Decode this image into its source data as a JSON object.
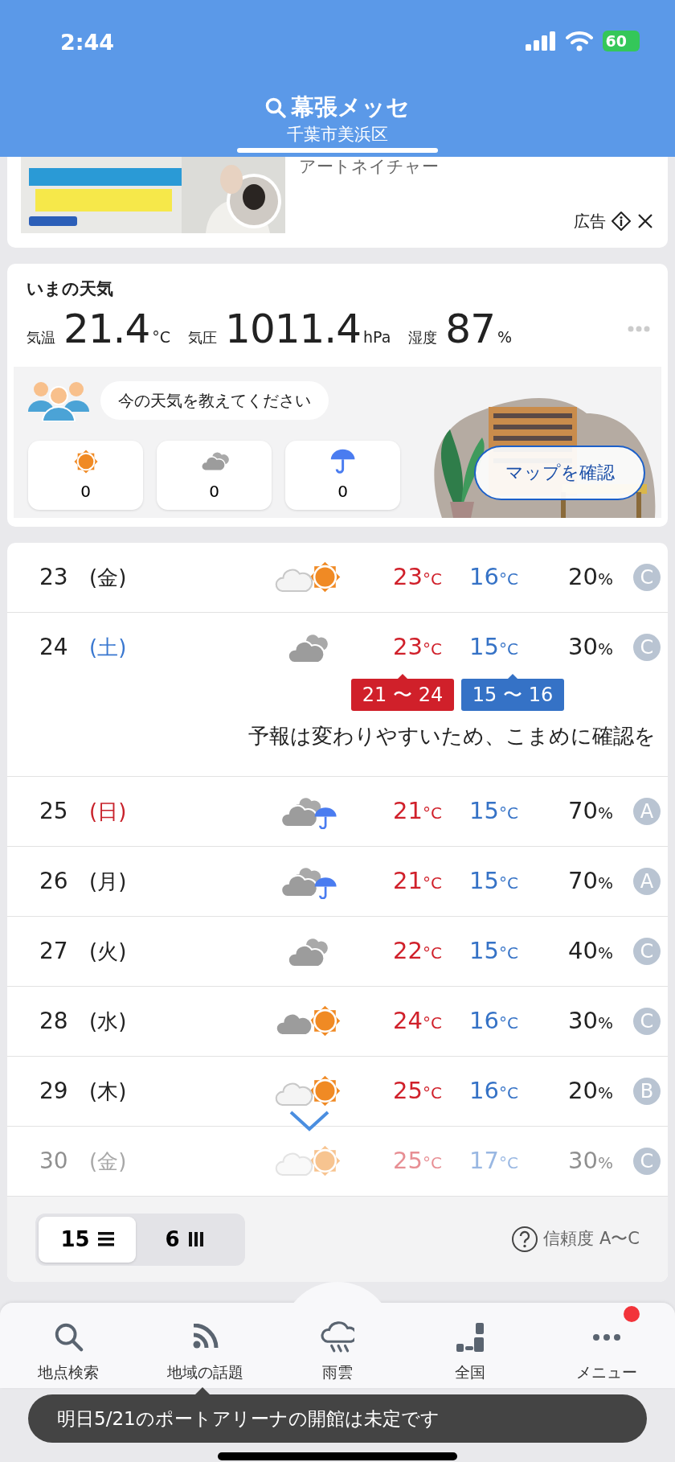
{
  "status_bar": {
    "time": "2:44",
    "battery": "60"
  },
  "header": {
    "title": "幕張メッセ",
    "subtitle": "千葉市美浜区"
  },
  "ad": {
    "kind": "picture",
    "advertiser": "アートネイチャー",
    "label": "広告"
  },
  "current": {
    "title": "いまの天気",
    "readings": [
      {
        "label": "気温",
        "value": "21.4",
        "unit": "°C"
      },
      {
        "label": "気圧",
        "value": "1011.4",
        "unit": "hPa"
      },
      {
        "label": "湿度",
        "value": "87",
        "unit": "%"
      }
    ],
    "prompt": "今の天気を教えてください",
    "reports": [
      {
        "kind": "sunny",
        "count": "0"
      },
      {
        "kind": "cloudy",
        "count": "0"
      },
      {
        "kind": "rain",
        "count": "0"
      }
    ],
    "map_button": "マップを確認"
  },
  "forecast": {
    "days": [
      {
        "date": "23",
        "weekday": "(金)",
        "color": "#222222",
        "kind": "partly_sunny",
        "high": "23",
        "high_unit": "°C",
        "low": "16",
        "low_unit": "°C",
        "pop": "20",
        "pop_unit": "%",
        "reliability": "C",
        "expanded": false,
        "faded": false
      },
      {
        "date": "24",
        "weekday": "(土)",
        "color": "#3a78d0",
        "kind": "cloudy",
        "high": "23",
        "high_unit": "°C",
        "low": "15",
        "low_unit": "°C",
        "pop": "30",
        "pop_unit": "%",
        "reliability": "C",
        "expanded": true,
        "faded": false,
        "high_range": "21 〜 24",
        "low_range": "15 〜 16",
        "note": "予報は変わりやすいため、こまめに確認を"
      },
      {
        "date": "25",
        "weekday": "(日)",
        "color": "#c8222b",
        "kind": "rain",
        "high": "21",
        "high_unit": "°C",
        "low": "15",
        "low_unit": "°C",
        "pop": "70",
        "pop_unit": "%",
        "reliability": "A",
        "expanded": false,
        "faded": false
      },
      {
        "date": "26",
        "weekday": "(月)",
        "color": "#222222",
        "kind": "rain",
        "high": "21",
        "high_unit": "°C",
        "low": "15",
        "low_unit": "°C",
        "pop": "70",
        "pop_unit": "%",
        "reliability": "A",
        "expanded": false,
        "faded": false
      },
      {
        "date": "27",
        "weekday": "(火)",
        "color": "#222222",
        "kind": "cloudy",
        "high": "22",
        "high_unit": "°C",
        "low": "15",
        "low_unit": "°C",
        "pop": "40",
        "pop_unit": "%",
        "reliability": "C",
        "expanded": false,
        "faded": false
      },
      {
        "date": "28",
        "weekday": "(水)",
        "color": "#222222",
        "kind": "mostly_cloudy",
        "high": "24",
        "high_unit": "°C",
        "low": "16",
        "low_unit": "°C",
        "pop": "30",
        "pop_unit": "%",
        "reliability": "C",
        "expanded": false,
        "faded": false
      },
      {
        "date": "29",
        "weekday": "(木)",
        "color": "#222222",
        "kind": "partly_sunny",
        "high": "25",
        "high_unit": "°C",
        "low": "16",
        "low_unit": "°C",
        "pop": "20",
        "pop_unit": "%",
        "reliability": "B",
        "expanded": false,
        "faded": false
      },
      {
        "date": "30",
        "weekday": "(金)",
        "color": "#a8a8a8",
        "kind": "partly_sunny",
        "high": "25",
        "high_unit": "°C",
        "low": "17",
        "low_unit": "°C",
        "pop": "30",
        "pop_unit": "%",
        "reliability": "C",
        "expanded": false,
        "faded": true
      }
    ],
    "views": [
      {
        "label": "15",
        "kind": "list",
        "selected": true
      },
      {
        "label": "6",
        "kind": "columns",
        "selected": false
      }
    ],
    "reliability_help": "信頼度 A〜C"
  },
  "nav": {
    "items": [
      {
        "label": "地点検索",
        "kind": "search",
        "raised": false,
        "badge": false
      },
      {
        "label": "地域の話題",
        "kind": "feed",
        "raised": false,
        "badge": false
      },
      {
        "label": "雨雲",
        "kind": "rain",
        "raised": true,
        "badge": false
      },
      {
        "label": "全国",
        "kind": "regions",
        "raised": false,
        "badge": false
      },
      {
        "label": "メニュー",
        "kind": "more",
        "raised": false,
        "badge": true
      }
    ],
    "toast": "明日5/21のポートアリーナの開館は未定です"
  }
}
